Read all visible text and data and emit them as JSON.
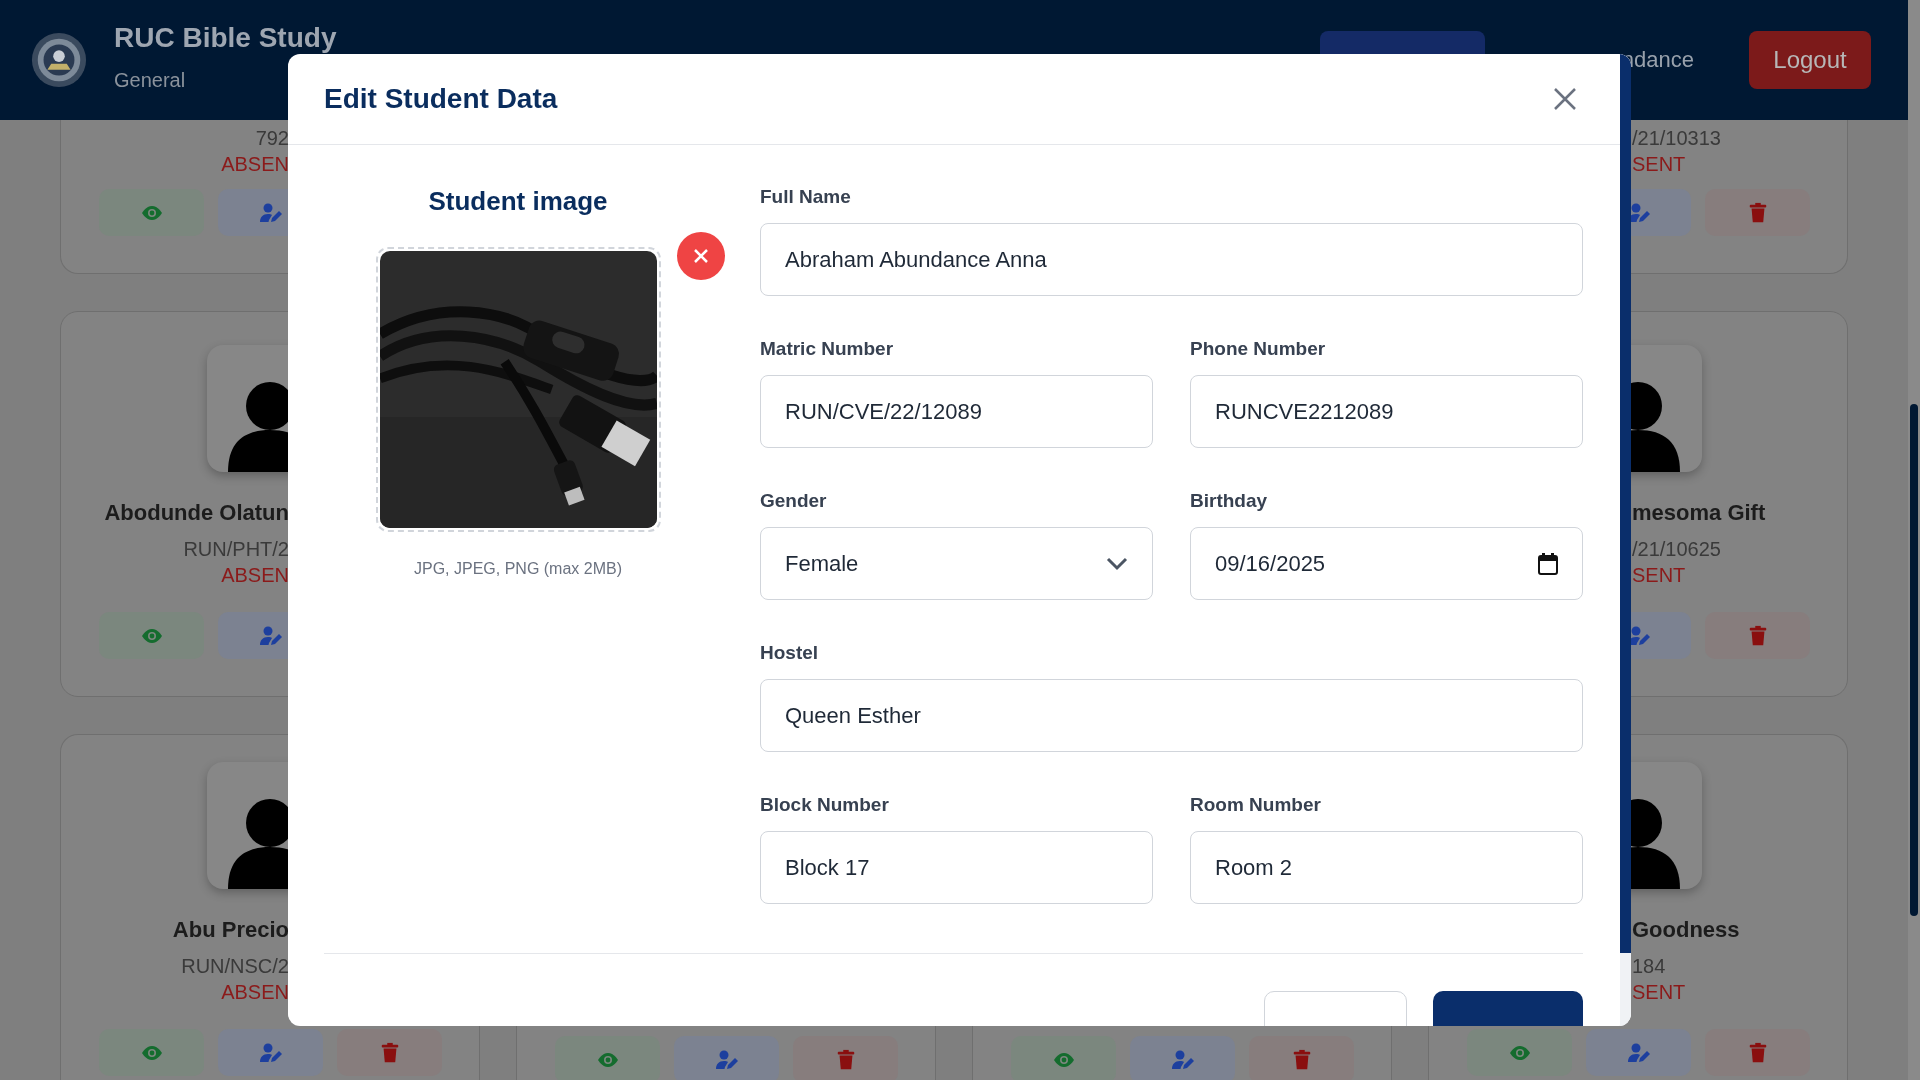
{
  "header": {
    "title": "RUC Bible Study",
    "subtitle": "General",
    "nav": [
      {
        "selected": true
      },
      {
        "label": "ndance",
        "selected": false
      }
    ],
    "logout": "Logout"
  },
  "card_columns": [
    {
      "cards": [
        {
          "matric": "792",
          "status": "ABSEN",
          "actions": [
            {
              "kind": "view"
            },
            {
              "kind": "edit"
            }
          ]
        },
        {
          "avatar": true,
          "name": "Abodunde Olatun",
          "matric": "RUN/PHT/2",
          "status": "ABSEN",
          "actions": [
            {
              "kind": "view"
            },
            {
              "kind": "edit"
            }
          ]
        },
        {
          "avatar": true,
          "name": "Abu Precio",
          "matric": "RUN/NSC/2",
          "status": "ABSEN",
          "actions": [
            {
              "kind": "view"
            },
            {
              "kind": "edit"
            },
            {
              "kind": "delete"
            }
          ]
        }
      ]
    },
    {
      "cards": [
        {
          "avatar": false,
          "actions": [
            {
              "kind": "view"
            },
            {
              "kind": "edit"
            },
            {
              "kind": "delete"
            }
          ]
        }
      ]
    },
    {
      "cards": [
        {
          "avatar": false,
          "actions": [
            {
              "kind": "view"
            },
            {
              "kind": "edit"
            },
            {
              "kind": "delete"
            }
          ]
        }
      ]
    },
    {
      "cards": [
        {
          "matric": "/21/10313",
          "status": "SENT",
          "actions": [
            {
              "kind": "edit"
            },
            {
              "kind": "delete"
            }
          ]
        },
        {
          "avatar": true,
          "name": "mesoma Gift",
          "matric": "/21/10625",
          "status": "SENT",
          "actions": [
            {
              "kind": "edit"
            },
            {
              "kind": "delete"
            }
          ]
        },
        {
          "avatar": true,
          "name": "Goodness",
          "matric": "184",
          "status": "SENT",
          "actions": [
            {
              "kind": "view"
            },
            {
              "kind": "edit"
            },
            {
              "kind": "delete"
            }
          ]
        }
      ]
    }
  ],
  "modal": {
    "title": "Edit Student Data",
    "image_heading": "Student image",
    "image_hint": "JPG, JPEG, PNG (max 2MB)",
    "form_rows": [
      [
        {
          "label": "Full Name",
          "value": "Abraham Abundance Anna",
          "kind": "text"
        }
      ],
      [
        {
          "label": "Matric Number",
          "value": "RUN/CVE/22/12089",
          "kind": "text"
        },
        {
          "label": "Phone Number",
          "value": "RUNCVE2212089",
          "kind": "text"
        }
      ],
      [
        {
          "label": "Gender",
          "value": "Female",
          "kind": "select"
        },
        {
          "label": "Birthday",
          "value": "09/16/2025",
          "kind": "date"
        }
      ],
      [
        {
          "label": "Hostel",
          "value": "Queen Esther",
          "kind": "text"
        }
      ],
      [
        {
          "label": "Block Number",
          "value": "Block 17",
          "kind": "text"
        },
        {
          "label": "Room Number",
          "value": "Room 2",
          "kind": "text"
        }
      ]
    ],
    "footer_buttons": [
      {
        "kind": "secondary"
      },
      {
        "kind": "primary"
      }
    ]
  }
}
